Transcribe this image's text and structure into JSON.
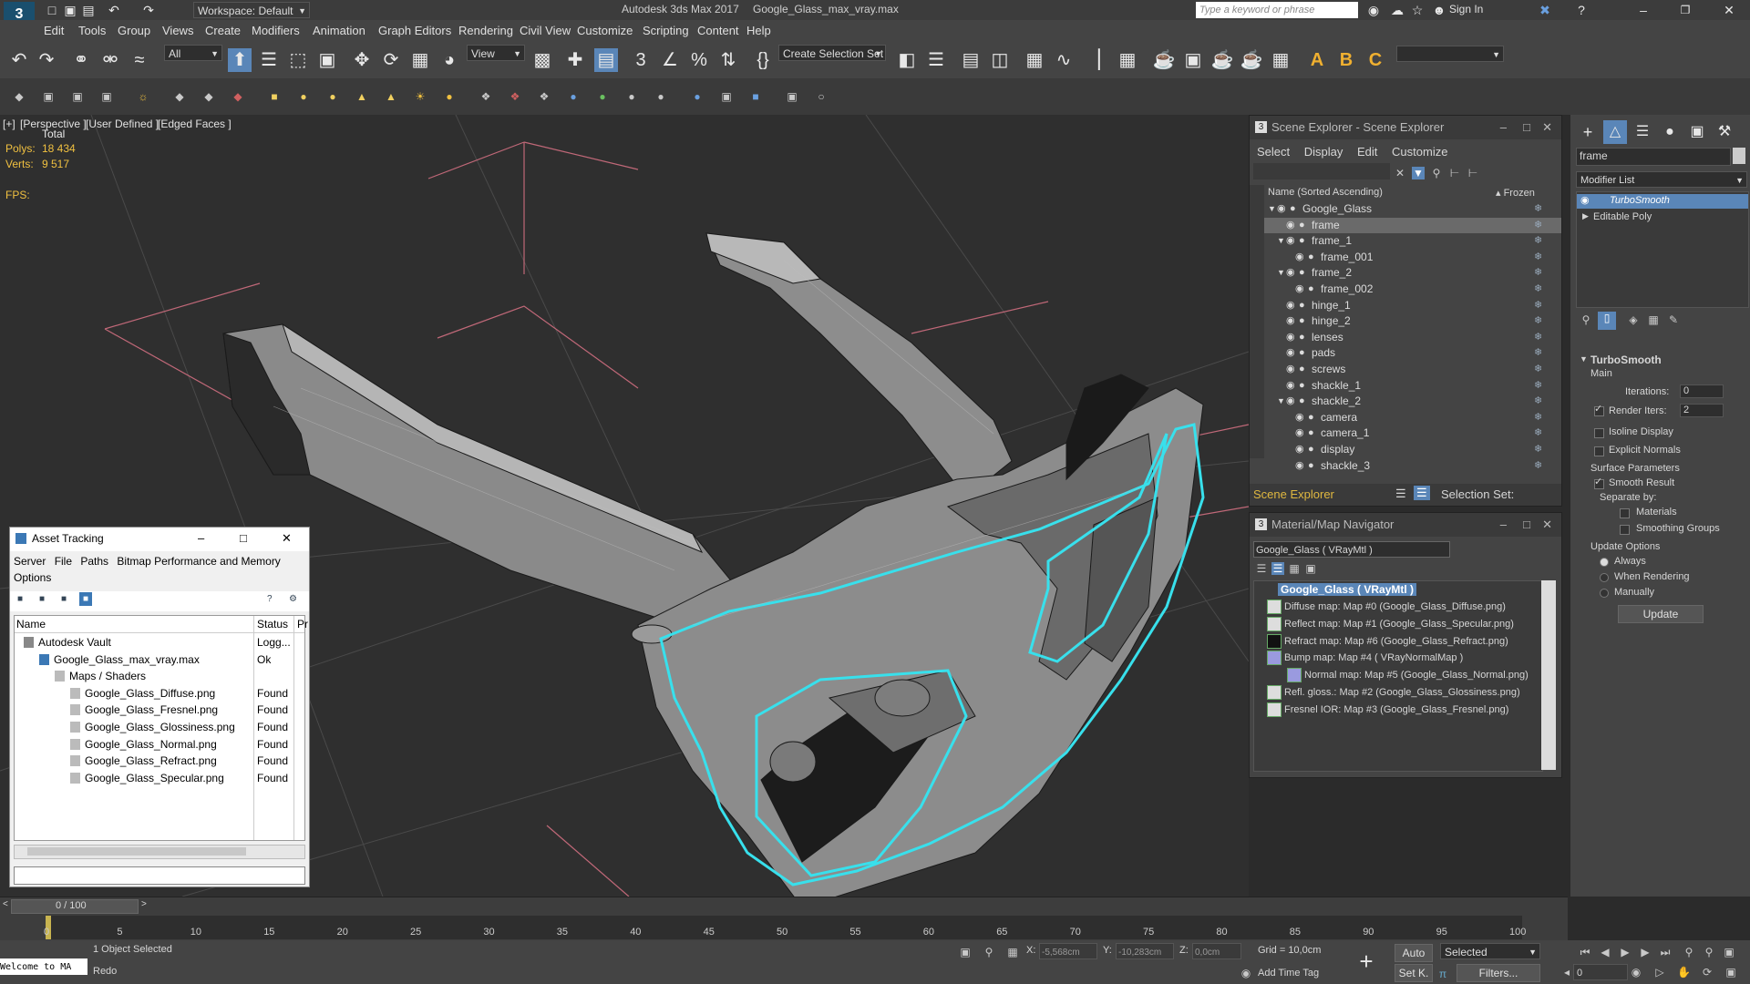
{
  "title": {
    "app": "Autodesk 3ds Max 2017",
    "file": "Google_Glass_max_vray.max",
    "workspace": "Workspace: Default",
    "search_placeholder": "Type a keyword or phrase",
    "signin": "Sign In"
  },
  "menu": [
    "Edit",
    "Tools",
    "Group",
    "Views",
    "Create",
    "Modifiers",
    "Animation",
    "Graph Editors",
    "Rendering",
    "Civil View",
    "Customize",
    "Scripting",
    "Content",
    "Help"
  ],
  "toolbar": {
    "filter_all": "All",
    "ref_coord": "View",
    "selection_set": "Create Selection Set"
  },
  "viewport": {
    "labels": [
      "[+]",
      "[Perspective ]",
      "[User Defined ]",
      "[Edged Faces ]"
    ],
    "total": "Total",
    "polys_label": "Polys:",
    "polys": "18 434",
    "verts_label": "Verts:",
    "verts": "9 517",
    "fps": "FPS:"
  },
  "scene_explorer": {
    "title": "Scene Explorer - Scene Explorer",
    "menu": [
      "Select",
      "Display",
      "Edit",
      "Customize"
    ],
    "col_name": "Name (Sorted Ascending)",
    "col_frozen": "▴ Frozen",
    "items": [
      {
        "name": "Google_Glass",
        "level": 0,
        "expanded": true
      },
      {
        "name": "frame",
        "level": 1,
        "selected": true
      },
      {
        "name": "frame_1",
        "level": 1,
        "expanded": true
      },
      {
        "name": "frame_001",
        "level": 2
      },
      {
        "name": "frame_2",
        "level": 1,
        "expanded": true
      },
      {
        "name": "frame_002",
        "level": 2
      },
      {
        "name": "hinge_1",
        "level": 1
      },
      {
        "name": "hinge_2",
        "level": 1
      },
      {
        "name": "lenses",
        "level": 1
      },
      {
        "name": "pads",
        "level": 1
      },
      {
        "name": "screws",
        "level": 1
      },
      {
        "name": "shackle_1",
        "level": 1
      },
      {
        "name": "shackle_2",
        "level": 1,
        "expanded": true
      },
      {
        "name": "camera",
        "level": 2
      },
      {
        "name": "camera_1",
        "level": 2
      },
      {
        "name": "display",
        "level": 2
      },
      {
        "name": "shackle_3",
        "level": 2
      }
    ],
    "footer": "Scene Explorer",
    "selection_set": "Selection Set:"
  },
  "material_nav": {
    "title": "Material/Map Navigator",
    "field": "Google_Glass  ( VRayMtl )",
    "root": "Google_Glass  ( VRayMtl )",
    "maps": [
      "Diffuse map: Map #0 (Google_Glass_Diffuse.png)",
      "Reflect map: Map #1 (Google_Glass_Specular.png)",
      "Refract map: Map #6 (Google_Glass_Refract.png)",
      "Bump map: Map #4  ( VRayNormalMap )",
      "Normal map: Map #5 (Google_Glass_Normal.png)",
      "Refl. gloss.: Map #2 (Google_Glass_Glossiness.png)",
      "Fresnel IOR: Map #3 (Google_Glass_Fresnel.png)"
    ]
  },
  "asset_tracking": {
    "title": "Asset Tracking",
    "menu": [
      "Server",
      "File",
      "Paths",
      "Bitmap Performance and Memory"
    ],
    "options": "Options",
    "col_name": "Name",
    "col_status": "Status",
    "col_pr": "Pr",
    "rows": [
      {
        "name": "Autodesk Vault",
        "status": "Logg...",
        "indent": 0
      },
      {
        "name": "Google_Glass_max_vray.max",
        "status": "Ok",
        "indent": 1
      },
      {
        "name": "Maps / Shaders",
        "status": "",
        "indent": 2
      },
      {
        "name": "Google_Glass_Diffuse.png",
        "status": "Found",
        "indent": 3
      },
      {
        "name": "Google_Glass_Fresnel.png",
        "status": "Found",
        "indent": 3
      },
      {
        "name": "Google_Glass_Glossiness.png",
        "status": "Found",
        "indent": 3
      },
      {
        "name": "Google_Glass_Normal.png",
        "status": "Found",
        "indent": 3
      },
      {
        "name": "Google_Glass_Refract.png",
        "status": "Found",
        "indent": 3
      },
      {
        "name": "Google_Glass_Specular.png",
        "status": "Found",
        "indent": 3
      }
    ]
  },
  "command_panel": {
    "name_field": "frame",
    "modifier_list": "Modifier List",
    "stack": [
      "TurboSmooth",
      "Editable Poly"
    ],
    "rollout": "TurboSmooth",
    "main": "Main",
    "iterations_label": "Iterations:",
    "iterations": "0",
    "render_iters_label": "Render Iters:",
    "render_iters": "2",
    "isoline": "Isoline Display",
    "explicit": "Explicit Normals",
    "surface_params": "Surface Parameters",
    "smooth_result": "Smooth Result",
    "separate_by": "Separate by:",
    "materials": "Materials",
    "smoothing_groups": "Smoothing Groups",
    "update_options": "Update Options",
    "always": "Always",
    "when_rendering": "When Rendering",
    "manually": "Manually",
    "update_btn": "Update"
  },
  "timeline": {
    "frame": "0 / 100",
    "ticks": [
      "0",
      "5",
      "10",
      "15",
      "20",
      "25",
      "30",
      "35",
      "40",
      "45",
      "50",
      "55",
      "60",
      "65",
      "70",
      "75",
      "80",
      "85",
      "90",
      "95",
      "100"
    ]
  },
  "status": {
    "selected": "1 Object Selected",
    "redo": "Redo",
    "maxscript": "Welcome to MA",
    "x_label": "X:",
    "x": "-5,568cm",
    "y_label": "Y:",
    "y": "-10,283cm",
    "z_label": "Z:",
    "z": "0,0cm",
    "grid": "Grid = 10,0cm",
    "add_time_tag": "Add Time Tag",
    "auto": "Auto",
    "set_key": "Set K.",
    "selected_dd": "Selected",
    "filters": "Filters...",
    "frame_field": "0"
  },
  "colors": {
    "selection_outline": "#38e0ec",
    "highlight": "#5a86b8",
    "stack_sel": "#5a86b8",
    "stat_yellow": "#f0c040"
  }
}
